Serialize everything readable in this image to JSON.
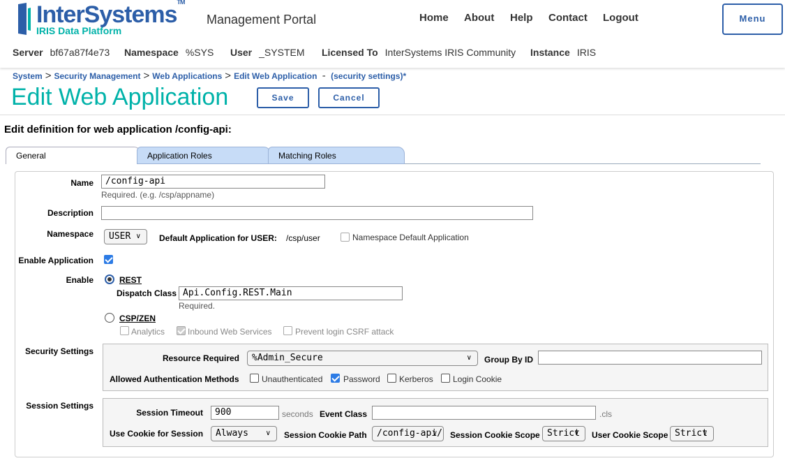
{
  "header": {
    "logo_word": "InterSystems",
    "logo_tm": "TM",
    "logo_sub": "IRIS Data Platform",
    "portal_title": "Management Portal",
    "nav": [
      "Home",
      "About",
      "Help",
      "Contact",
      "Logout"
    ],
    "menu_label": "Menu"
  },
  "info": {
    "server_label": "Server",
    "server": "bf67a87f4e73",
    "namespace_label": "Namespace",
    "namespace": "%SYS",
    "user_label": "User",
    "user": "_SYSTEM",
    "licensed_label": "Licensed To",
    "licensed": "InterSystems IRIS Community",
    "instance_label": "Instance",
    "instance": "IRIS"
  },
  "breadcrumb": {
    "items": [
      "System",
      "Security Management",
      "Web Applications",
      "Edit Web Application"
    ],
    "separator": ">",
    "dash": "-",
    "extra": "(security settings)*"
  },
  "page": {
    "title": "Edit Web Application",
    "save": "Save",
    "cancel": "Cancel",
    "section_title": "Edit definition for web application /config-api:"
  },
  "tabs": [
    "General",
    "Application Roles",
    "Matching Roles"
  ],
  "form": {
    "name_label": "Name",
    "name_value": "/config-api",
    "name_hint": "Required. (e.g. /csp/appname)",
    "description_label": "Description",
    "description_value": "",
    "namespace_label": "Namespace",
    "namespace_value": "USER",
    "default_app_label": "Default Application for USER:",
    "default_app_value": "/csp/user",
    "ns_default_label": "Namespace Default Application",
    "enable_app_label": "Enable Application",
    "enable_label": "Enable",
    "rest_label": "REST",
    "dispatch_label": "Dispatch Class",
    "dispatch_value": "Api.Config.REST.Main",
    "dispatch_hint": "Required.",
    "csp_label": "CSP/ZEN",
    "analytics_label": "Analytics",
    "inbound_label": "Inbound Web Services",
    "csrf_label": "Prevent login CSRF attack",
    "security_label": "Security Settings",
    "resource_label": "Resource Required",
    "resource_value": "%Admin_Secure",
    "group_label": "Group By ID",
    "group_value": "",
    "auth_label": "Allowed Authentication Methods",
    "auth_unauth": "Unauthenticated",
    "auth_password": "Password",
    "auth_kerberos": "Kerberos",
    "auth_cookie": "Login Cookie",
    "session_label": "Session Settings",
    "timeout_label": "Session Timeout",
    "timeout_value": "900",
    "seconds": "seconds",
    "event_label": "Event Class",
    "event_value": "",
    "cls": ".cls",
    "use_cookie_label": "Use Cookie for Session",
    "use_cookie_value": "Always",
    "cookie_path_label": "Session Cookie Path",
    "cookie_path_value": "/config-api/",
    "cookie_scope_label": "Session Cookie Scope",
    "cookie_scope_value": "Strict",
    "user_cookie_scope_label": "User Cookie Scope",
    "user_cookie_scope_value": "Strict"
  },
  "colors": {
    "brand_blue": "#2c5ea8",
    "accent_teal": "#00b2a9",
    "tab_inactive": "#c7dcf7"
  }
}
